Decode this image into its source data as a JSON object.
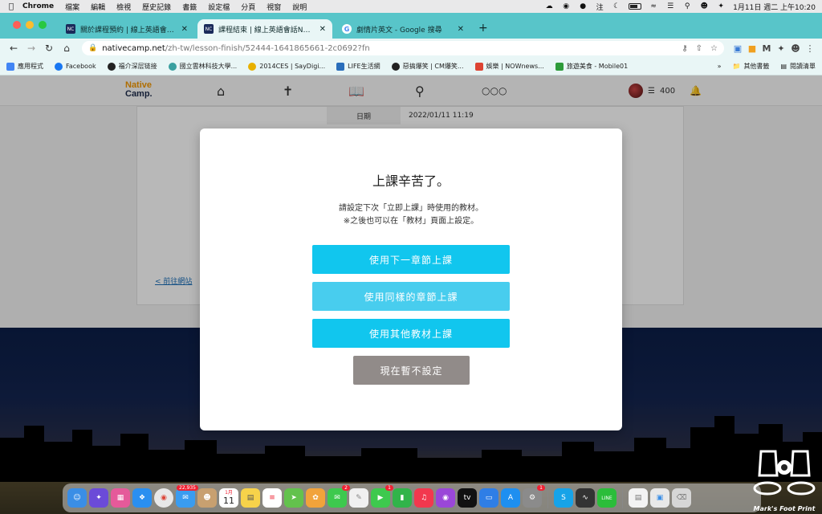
{
  "menubar": {
    "app": "Chrome",
    "items": [
      "檔案",
      "編輯",
      "檢視",
      "歷史記錄",
      "書籤",
      "設定檔",
      "分頁",
      "視窗",
      "說明"
    ],
    "clock": "1月11日 週二 上午10:20",
    "input_method": "注"
  },
  "tabs": [
    {
      "favicon": "NC",
      "title": "關於課程預約 | 線上英語會話Native",
      "active": false
    },
    {
      "favicon": "NC",
      "title": "課程結束 | 線上英語會話NativeC",
      "active": true
    },
    {
      "favicon": "G",
      "title": "劇情片英文 - Google 搜尋",
      "active": false
    }
  ],
  "address": {
    "host": "nativecamp.net",
    "path": "/zh-tw/lesson-finish/52444-1641865661-2c0692?fn"
  },
  "bookmarks": {
    "items": [
      {
        "label": "應用程式",
        "color": "#4285f4"
      },
      {
        "label": "Facebook",
        "color": "#1877f2"
      },
      {
        "label": "福介深层链接",
        "color": "#222222"
      },
      {
        "label": "國立雲林科技大學...",
        "color": "#3aa0a0"
      },
      {
        "label": "2014CES | SayDigi...",
        "color": "#e8b100"
      },
      {
        "label": "LIFE生活網",
        "color": "#2a6ebb"
      },
      {
        "label": "惡搞爆笑 | CM爆笑...",
        "color": "#222222"
      },
      {
        "label": "娛樂 | NOWnews...",
        "color": "#d43"
      },
      {
        "label": "旅遊美食 - Mobile01",
        "color": "#2d9b3a"
      }
    ],
    "more": "»",
    "other": "其他書籤",
    "reading_list": "閱讀清單"
  },
  "site": {
    "logo_top": "Native",
    "logo_bottom": "Camp.",
    "coins": "400",
    "date_label": "日期",
    "date_value": "2022/01/11 11:19",
    "back_link": "< 前往網站"
  },
  "modal": {
    "title": "上課辛苦了。",
    "line1": "請設定下次「立即上課」時使用的教材。",
    "line2": "※之後也可以在「教材」頁面上設定。",
    "btn_next": "使用下一章節上課",
    "btn_same": "使用同樣的章節上課",
    "btn_other": "使用其他教材上課",
    "btn_skip": "現在暫不設定"
  },
  "dock": {
    "mail_badge": "22,935",
    "calendar_month": "1月",
    "calendar_day": "11",
    "messages_badge": "2",
    "facetime_badge": "1",
    "prefs_badge": "1",
    "apps": [
      {
        "name": "finder",
        "color": "#3a8ee6"
      },
      {
        "name": "siri",
        "color": "#6b4bd8"
      },
      {
        "name": "launchpad",
        "color": "#e55a9a"
      },
      {
        "name": "safari",
        "color": "#2a8ff0"
      },
      {
        "name": "chrome",
        "color": "#e8e8e8"
      },
      {
        "name": "mail",
        "color": "#3a9cf0"
      },
      {
        "name": "contacts",
        "color": "#c8a070"
      },
      {
        "name": "calendar",
        "color": "#ffffff"
      },
      {
        "name": "notes",
        "color": "#f7d24a"
      },
      {
        "name": "reminders",
        "color": "#ffffff"
      },
      {
        "name": "maps",
        "color": "#63c24d"
      },
      {
        "name": "photos",
        "color": "#f1a33b"
      },
      {
        "name": "messages",
        "color": "#3ec94e"
      },
      {
        "name": "freeform",
        "color": "#f0f0f0"
      },
      {
        "name": "facetime",
        "color": "#3ec94e"
      },
      {
        "name": "numbers",
        "color": "#31b44a"
      },
      {
        "name": "music",
        "color": "#f2384e"
      },
      {
        "name": "podcasts",
        "color": "#9a47d8"
      },
      {
        "name": "apple-tv",
        "color": "#111111"
      },
      {
        "name": "keynote",
        "color": "#2f7ee6"
      },
      {
        "name": "app-store",
        "color": "#1e8ff0"
      },
      {
        "name": "system-preferences",
        "color": "#8b8b8b"
      },
      {
        "name": "skype",
        "color": "#17a3e8"
      },
      {
        "name": "activity-monitor",
        "color": "#333333"
      },
      {
        "name": "line",
        "color": "#2bbd3a"
      },
      {
        "name": "document",
        "color": "#f3f3f3"
      },
      {
        "name": "screenshot",
        "color": "#e8e8e8"
      },
      {
        "name": "trash",
        "color": "#d6d6d6"
      }
    ]
  },
  "watermark": "Mark's Foot Print"
}
